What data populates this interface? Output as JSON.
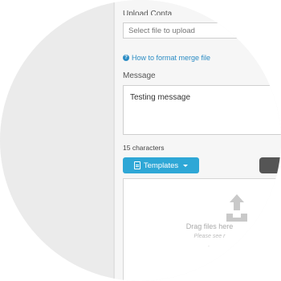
{
  "form": {
    "upload_label": "Upload Conta",
    "upload_placeholder": "Select file to upload",
    "help_link": "How to format merge file",
    "message_label": "Message",
    "message_value": "Testing message",
    "char_count": "15 characters",
    "templates_label": "Templates"
  },
  "dropzone": {
    "title": "Drag files here",
    "subtitle": "Please see r",
    "dot": "."
  },
  "colors": {
    "accent": "#2ea7d6",
    "link": "#2b8cc4",
    "dark_button": "#555555"
  },
  "icons": [
    "help-icon",
    "document-icon",
    "caret-down-icon",
    "upload-icon"
  ]
}
